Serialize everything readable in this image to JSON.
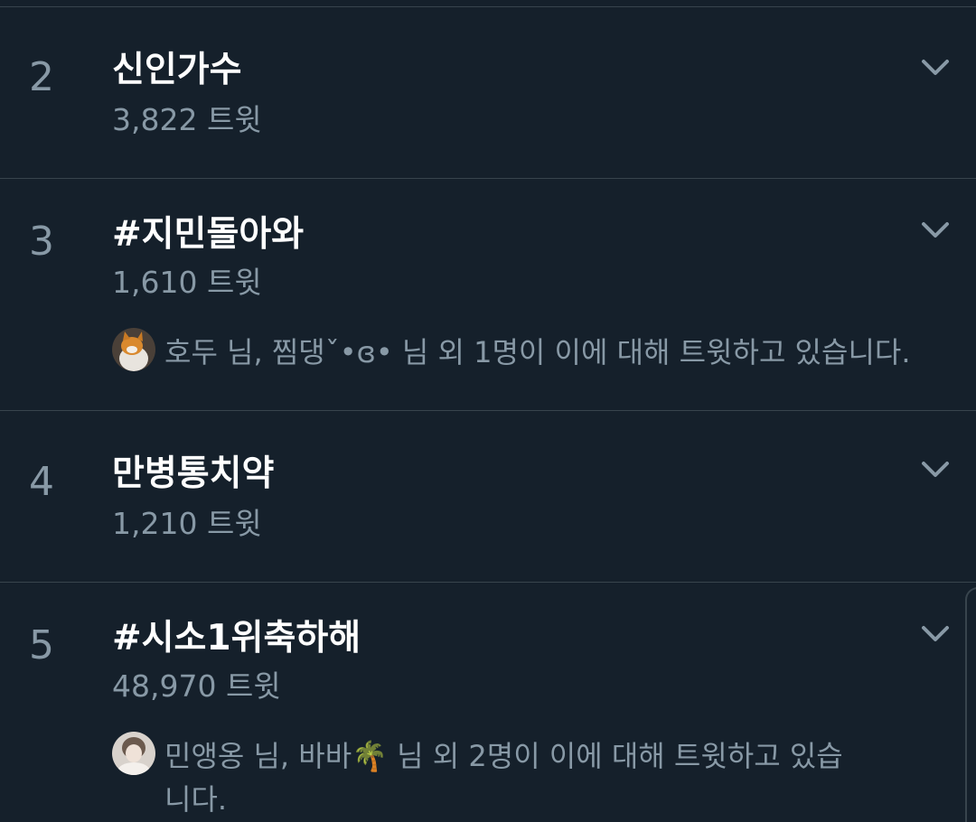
{
  "trends": [
    {
      "rank": "2",
      "title": "신인가수",
      "count": "3,822 트윗",
      "context": null
    },
    {
      "rank": "3",
      "title": "#지민돌아와",
      "count": "1,610 트윗",
      "context": "호두 님, 찜댕ˇ•ɞ• 님 외 1명이 이에 대해 트윗하고 있습니다."
    },
    {
      "rank": "4",
      "title": "만병통치약",
      "count": "1,210 트윗",
      "context": null
    },
    {
      "rank": "5",
      "title": "#시소1위축하해",
      "count": "48,970 트윗",
      "context": "민앵옹 님, 바바🌴 님 외 2명이 이에 대해 트윗하고 있습니다."
    }
  ],
  "icons": {
    "chevron": "chevron-down-icon",
    "avatar": "user-avatar"
  },
  "colors": {
    "background": "#15202b",
    "divider": "#38444d",
    "secondary_text": "#8899a6",
    "primary_text": "#ffffff"
  }
}
